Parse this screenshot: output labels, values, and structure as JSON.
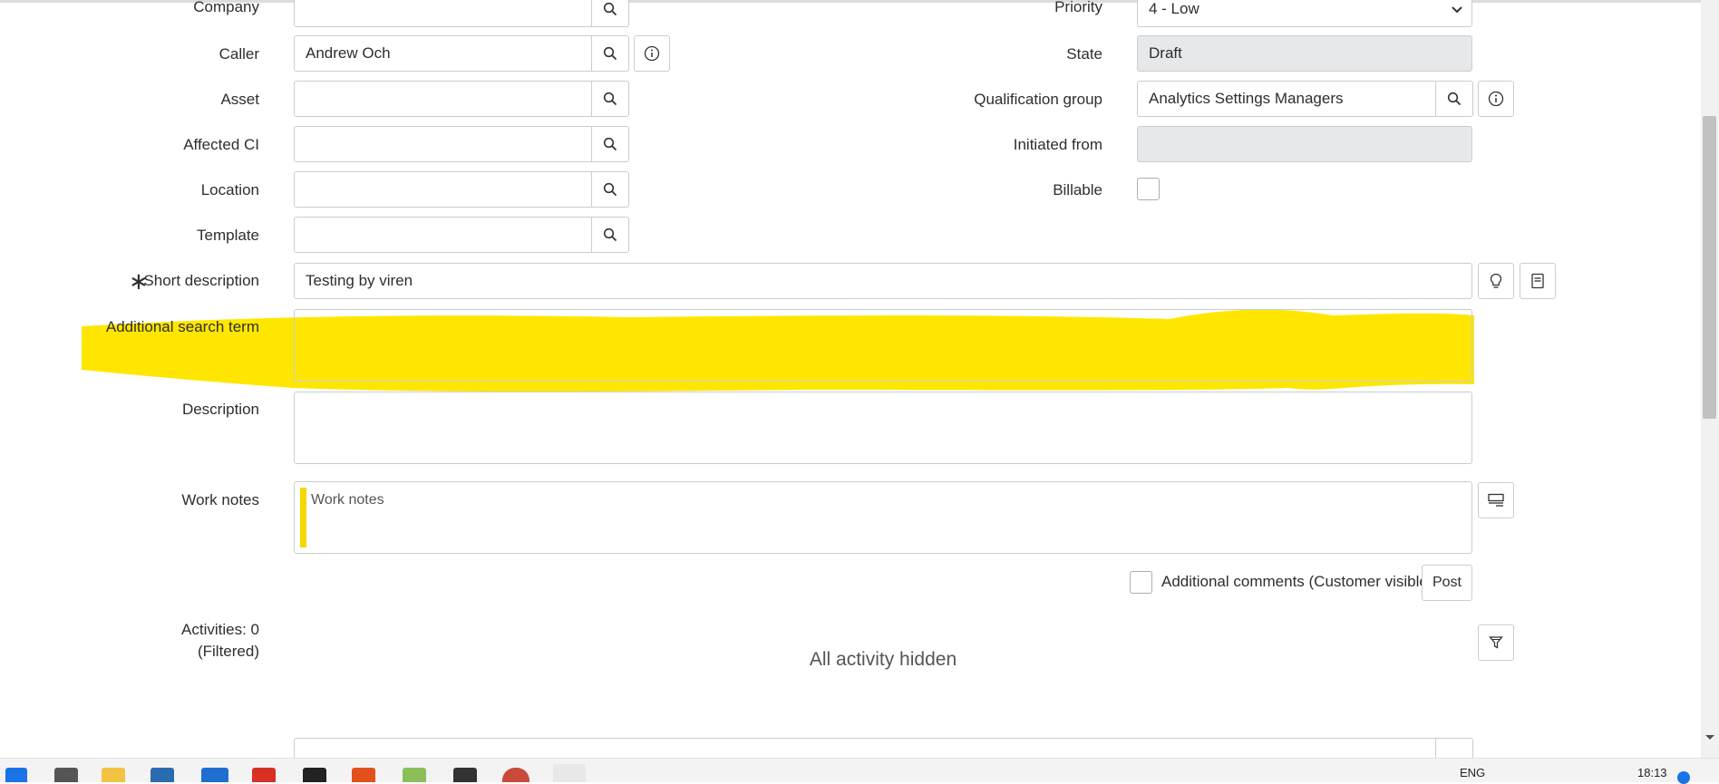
{
  "form": {
    "company": {
      "label": "Company",
      "value": ""
    },
    "caller": {
      "label": "Caller",
      "value": "Andrew Och"
    },
    "asset": {
      "label": "Asset",
      "value": ""
    },
    "affected_ci": {
      "label": "Affected CI",
      "value": ""
    },
    "location": {
      "label": "Location",
      "value": ""
    },
    "template": {
      "label": "Template",
      "value": ""
    },
    "priority": {
      "label": "Priority",
      "value": "4 - Low"
    },
    "state": {
      "label": "State",
      "value": "Draft"
    },
    "qualification_group": {
      "label": "Qualification group",
      "value": "Analytics Settings Managers"
    },
    "initiated_from": {
      "label": "Initiated from",
      "value": ""
    },
    "billable": {
      "label": "Billable",
      "checked": false
    },
    "short_description": {
      "label": "Short description",
      "required_mark": "∗",
      "value": "Testing by viren"
    },
    "additional_search_term": {
      "label": "Additional search term",
      "value": ""
    },
    "description": {
      "label": "Description",
      "value": ""
    },
    "work_notes": {
      "label": "Work notes",
      "placeholder": "Work notes"
    },
    "additional_comments": {
      "label": "Additional comments (Customer visible)",
      "checked": false
    },
    "post_label": "Post"
  },
  "activities": {
    "label_line1": "Activities: 0",
    "label_line2": "(Filtered)",
    "empty_message": "All activity hidden"
  },
  "colors": {
    "highlight": "#ffe600",
    "worknote_bar": "#f5d800",
    "border": "#c8cdd1",
    "readonly_bg": "#e6e8ea"
  },
  "taskbar": {
    "language": "ENG",
    "time": "18:13"
  }
}
